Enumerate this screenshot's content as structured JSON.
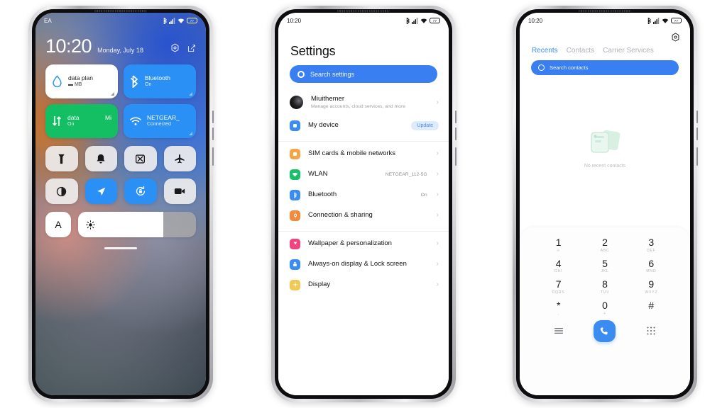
{
  "phone1": {
    "name": "control-center",
    "status_bar": {
      "carrier": "EA",
      "icons": [
        "bluetooth-icon",
        "signal-icon",
        "wifi-icon",
        "battery-icon"
      ],
      "battery_label": "77"
    },
    "clock": {
      "time": "10:20",
      "date": "Monday, July 18",
      "actions": [
        "settings-gear-icon",
        "edit-icon"
      ]
    },
    "big_tiles": [
      {
        "name": "data-plan-tile",
        "title": "data plan",
        "value": "MB",
        "state": "off",
        "icon": "droplet-icon",
        "style": "tile-white"
      },
      {
        "name": "bluetooth-tile",
        "title": "Bluetooth",
        "value": "On",
        "state": "on",
        "icon": "bluetooth-icon",
        "style": "tile-blue"
      },
      {
        "name": "mobile-data-tile",
        "title": "data",
        "title_right": "Mi",
        "value": "On",
        "state": "on",
        "icon": "data-arrows-icon",
        "style": "tile-green"
      },
      {
        "name": "wifi-tile",
        "title": "NETGEAR_",
        "value": "Connected",
        "state": "on",
        "icon": "wifi-icon",
        "style": "tile-blue"
      }
    ],
    "quick_tiles": [
      {
        "name": "flashlight-toggle",
        "icon": "flashlight-icon",
        "state": "off"
      },
      {
        "name": "ringer-toggle",
        "icon": "bell-icon",
        "state": "off"
      },
      {
        "name": "screenshot-toggle",
        "icon": "screenshot-icon",
        "state": "off"
      },
      {
        "name": "airplane-mode-toggle",
        "icon": "airplane-icon",
        "state": "off"
      },
      {
        "name": "dark-mode-toggle",
        "icon": "contrast-icon",
        "state": "off"
      },
      {
        "name": "location-toggle",
        "icon": "location-arrow-icon",
        "state": "on"
      },
      {
        "name": "rotation-lock-toggle",
        "icon": "rotation-lock-icon",
        "state": "on"
      },
      {
        "name": "screen-recorder-toggle",
        "icon": "video-camera-icon",
        "state": "off"
      }
    ],
    "brightness": {
      "auto_label": "A",
      "icon": "brightness-sun-icon",
      "percent": 72
    }
  },
  "phone2": {
    "name": "settings",
    "status_bar": {
      "time": "10:20",
      "icons": [
        "bluetooth-icon",
        "signal-icon",
        "wifi-icon",
        "battery-icon"
      ],
      "battery_label": "77"
    },
    "title": "Settings",
    "search": {
      "placeholder": "Search settings",
      "icon": "search-icon"
    },
    "groups": [
      {
        "rows": [
          {
            "name": "account-row",
            "label": "Miuithemer",
            "sub": "Manage accounts, cloud services, and more",
            "icon": "account-avatar",
            "icon_color": "#1d1d20",
            "chevron": "›"
          },
          {
            "name": "my-device-row",
            "label": "My device",
            "icon": "device-icon",
            "icon_color": "#3a8cf0",
            "badge": "Update"
          }
        ]
      },
      {
        "rows": [
          {
            "name": "sim-cards-row",
            "label": "SIM cards & mobile networks",
            "icon": "sim-icon",
            "icon_color": "#f0a649",
            "chevron": "›"
          },
          {
            "name": "wlan-row",
            "label": "WLAN",
            "value": "NETGEAR_112-5G",
            "icon": "wifi-icon",
            "icon_color": "#18c06a",
            "chevron": "›"
          },
          {
            "name": "bluetooth-row",
            "label": "Bluetooth",
            "value": "On",
            "icon": "bluetooth-icon",
            "icon_color": "#3a8cf0",
            "chevron": "›"
          },
          {
            "name": "connection-sharing-row",
            "label": "Connection & sharing",
            "icon": "share-icon",
            "icon_color": "#f08a3c",
            "chevron": "›"
          }
        ]
      },
      {
        "rows": [
          {
            "name": "wallpaper-row",
            "label": "Wallpaper & personalization",
            "icon": "palette-icon",
            "icon_color": "#f2437f",
            "chevron": "›"
          },
          {
            "name": "aod-lockscreen-row",
            "label": "Always-on display & Lock screen",
            "icon": "lock-icon",
            "icon_color": "#3a8cf0",
            "chevron": "›"
          },
          {
            "name": "display-row",
            "label": "Display",
            "icon": "brightness-icon",
            "icon_color": "#f0c954",
            "chevron": "›"
          }
        ]
      }
    ]
  },
  "phone3": {
    "name": "dialer",
    "status_bar": {
      "time": "10:20",
      "icons": [
        "bluetooth-icon",
        "signal-icon",
        "wifi-icon",
        "battery-icon"
      ],
      "battery_label": "77"
    },
    "gear": "settings-gear-icon",
    "tabs": [
      {
        "label": "Recents",
        "active": true
      },
      {
        "label": "Contacts",
        "active": false
      },
      {
        "label": "Carrier Services",
        "active": false
      }
    ],
    "search": {
      "placeholder": "Search contacts",
      "icon": "search-icon"
    },
    "empty_state": {
      "text": "No recent contacts",
      "icon": "empty-contacts-icon"
    },
    "keypad": [
      {
        "num": "1",
        "sub": "∞"
      },
      {
        "num": "2",
        "sub": "ABC"
      },
      {
        "num": "3",
        "sub": "DEF"
      },
      {
        "num": "4",
        "sub": "GHI"
      },
      {
        "num": "5",
        "sub": "JKL"
      },
      {
        "num": "6",
        "sub": "MNO"
      },
      {
        "num": "7",
        "sub": "PQRS"
      },
      {
        "num": "8",
        "sub": "TUV"
      },
      {
        "num": "9",
        "sub": "WXYZ"
      },
      {
        "num": "*",
        "sub": ","
      },
      {
        "num": "0",
        "sub": "+"
      },
      {
        "num": "#",
        "sub": ""
      }
    ],
    "actions": {
      "left": "menu-icon",
      "call": "phone-call-icon",
      "right": "keypad-icon"
    }
  },
  "colors": {
    "accent_blue": "#3a8cf0",
    "tile_blue": "#2a90f5",
    "tile_green": "#13bf62",
    "page_bg": "#ffffff"
  }
}
